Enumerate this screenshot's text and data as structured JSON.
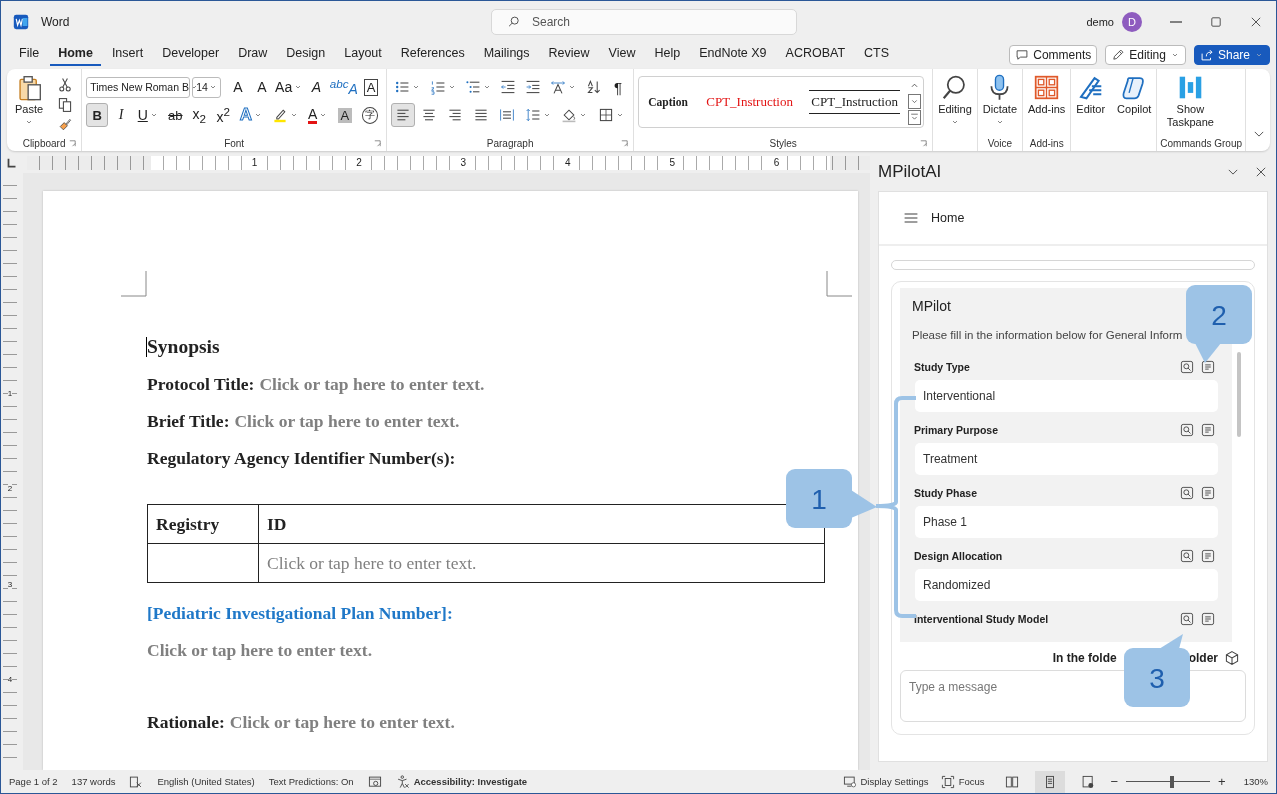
{
  "window": {
    "app_name": "Word",
    "search_placeholder": "Search",
    "user": "demo",
    "avatar_initial": "D"
  },
  "menu_tabs": [
    {
      "label": "File",
      "selected": false
    },
    {
      "label": "Home",
      "selected": true
    },
    {
      "label": "Insert",
      "selected": false
    },
    {
      "label": "Developer",
      "selected": false
    },
    {
      "label": "Draw",
      "selected": false
    },
    {
      "label": "Design",
      "selected": false
    },
    {
      "label": "Layout",
      "selected": false
    },
    {
      "label": "References",
      "selected": false
    },
    {
      "label": "Mailings",
      "selected": false
    },
    {
      "label": "Review",
      "selected": false
    },
    {
      "label": "View",
      "selected": false
    },
    {
      "label": "Help",
      "selected": false
    },
    {
      "label": "EndNote X9",
      "selected": false
    },
    {
      "label": "ACROBAT",
      "selected": false
    },
    {
      "label": "CTS",
      "selected": false
    }
  ],
  "header_buttons": [
    {
      "kind": "comments",
      "label": "Comments"
    },
    {
      "kind": "editing",
      "label": "Editing"
    },
    {
      "kind": "share",
      "label": "Share"
    }
  ],
  "ribbon": {
    "clipboard": {
      "label": "Paste",
      "group_label": "Clipboard"
    },
    "font": {
      "group_label": "Font",
      "font_name": "Times New Roman B",
      "font_size": "14",
      "row1": [
        {
          "kind": "grow",
          "label": "A"
        },
        {
          "kind": "shrink",
          "label": "A"
        },
        {
          "kind": "case",
          "label": "Aa",
          "dropdown": true
        },
        {
          "kind": "clear",
          "label": "A"
        },
        {
          "kind": "phonetic",
          "label": "$^{abc}$A"
        },
        {
          "kind": "charborder",
          "label": "A"
        }
      ],
      "row2": [
        {
          "kind": "bold",
          "label": "B",
          "selected": true
        },
        {
          "kind": "italic",
          "label": "I",
          "selected": false
        },
        {
          "kind": "underline",
          "label": "U",
          "selected": false,
          "dropdown": true
        },
        {
          "kind": "strike",
          "label": "ab",
          "selected": false
        },
        {
          "kind": "subscript",
          "label": "x$_{2}$",
          "selected": false
        },
        {
          "kind": "superscript",
          "label": "x$^{2}$",
          "selected": false
        },
        {
          "kind": "effects",
          "label": "A",
          "dropdown": true
        },
        {
          "kind": "highlight",
          "dropdown": true
        },
        {
          "kind": "color",
          "label": "A",
          "dropdown": true
        },
        {
          "kind": "shading",
          "label": "A"
        },
        {
          "kind": "enclose",
          "label": "字"
        }
      ]
    },
    "paragraph": {
      "group_label": "Paragraph",
      "row1": [
        {
          "kind": "bullets",
          "dropdown": true
        },
        {
          "kind": "numbering",
          "dropdown": true
        },
        {
          "kind": "multilevel",
          "dropdown": true
        },
        {
          "kind": "outdent"
        },
        {
          "kind": "indent"
        },
        {
          "kind": "textdir",
          "dropdown": true
        },
        {
          "kind": "sort"
        },
        {
          "kind": "marks",
          "label": "¶"
        }
      ],
      "row2": [
        {
          "kind": "align-left",
          "selected": true
        },
        {
          "kind": "align-center",
          "selected": false
        },
        {
          "kind": "align-right",
          "selected": false
        },
        {
          "kind": "justify",
          "selected": false
        },
        {
          "kind": "distributed",
          "selected": false
        },
        {
          "kind": "linespacing",
          "dropdown": true
        },
        {
          "kind": "fill",
          "dropdown": true
        },
        {
          "kind": "borders",
          "dropdown": true
        }
      ]
    },
    "styles": {
      "group_label": "Styles",
      "items": [
        {
          "kind": "caption",
          "label": "Caption"
        },
        {
          "kind": "instruction",
          "label": "CPT_Instruction"
        },
        {
          "kind": "instruction-lined",
          "label": "CPT_Instruction"
        }
      ]
    },
    "groups": [
      {
        "buttons": [
          {
            "kind": "find",
            "label": "Editing",
            "dropdown": true
          }
        ]
      },
      {
        "label": "Voice",
        "buttons": [
          {
            "kind": "mic",
            "label": "Dictate",
            "dropdown": true
          }
        ]
      },
      {
        "label": "Add-ins",
        "buttons": [
          {
            "kind": "addins",
            "label": "Add-ins"
          }
        ]
      },
      {
        "buttons": [
          {
            "kind": "editor",
            "label": "Editor"
          },
          {
            "kind": "copilot",
            "label": "Copilot"
          }
        ]
      },
      {
        "label": "Commands Group",
        "buttons": [
          {
            "kind": "taskpane",
            "label": "Show Taskpane"
          }
        ]
      }
    ]
  },
  "ruler": {
    "numbers": [
      "1",
      "2",
      "3",
      "4",
      "5",
      "6"
    ],
    "vertical_numbers": [
      "1",
      "2",
      "3",
      "4"
    ]
  },
  "document": [
    {
      "kind": "heading",
      "text": "Synopsis"
    },
    {
      "kind": "field",
      "label": "Protocol Title:",
      "prompt": "Click or tap here to enter text."
    },
    {
      "kind": "field",
      "label": "Brief Title:",
      "prompt": "Click or tap here to enter text."
    },
    {
      "kind": "label",
      "text": "Regulatory Agency Identifier Number(s):"
    },
    {
      "kind": "table",
      "columns": [
        "Registry",
        "ID"
      ],
      "rows": [
        {
          "id": "Click or tap here to enter text."
        }
      ]
    },
    {
      "kind": "link-heading",
      "text": "[Pediatric Investigational Plan Number]:"
    },
    {
      "kind": "prompt",
      "text": "Click or tap here to enter text."
    },
    {
      "kind": "field",
      "label": "Rationale:",
      "prompt": "Click or tap here to enter text."
    }
  ],
  "pane": {
    "title": "MPilotAI",
    "nav_label": "Home",
    "card_title": "MPilot",
    "description": "Please fill in the information below for General Inform",
    "fields": [
      {
        "label": "Study Type",
        "value": "Interventional"
      },
      {
        "label": "Primary Purpose",
        "value": "Treatment"
      },
      {
        "label": "Study Phase",
        "value": "Phase 1"
      },
      {
        "label": "Design Allocation",
        "value": "Randomized"
      },
      {
        "label": "Interventional Study Model"
      }
    ],
    "footer_text_before": "In the folde",
    "footer_text_after": "older",
    "message_placeholder": "Type a message"
  },
  "callouts": [
    {
      "number": "1"
    },
    {
      "number": "2"
    },
    {
      "number": "3"
    }
  ],
  "status_bar": {
    "left": [
      {
        "kind": "text",
        "text": "Page 1 of 2"
      },
      {
        "kind": "text",
        "text": "137 words"
      },
      {
        "kind": "proofing"
      },
      {
        "kind": "text",
        "text": "English (United States)"
      },
      {
        "kind": "text",
        "text": "Text Predictions: On"
      },
      {
        "kind": "macro"
      },
      {
        "kind": "accessibility",
        "text": "Accessibility: Investigate"
      }
    ],
    "display_settings": "Display Settings",
    "focus": "Focus",
    "views": [
      {
        "kind": "read",
        "selected": false
      },
      {
        "kind": "print",
        "selected": true
      },
      {
        "kind": "web",
        "selected": false
      }
    ],
    "zoom": {
      "minus": "−",
      "plus": "+",
      "level": 0.55,
      "value": "130%"
    }
  }
}
